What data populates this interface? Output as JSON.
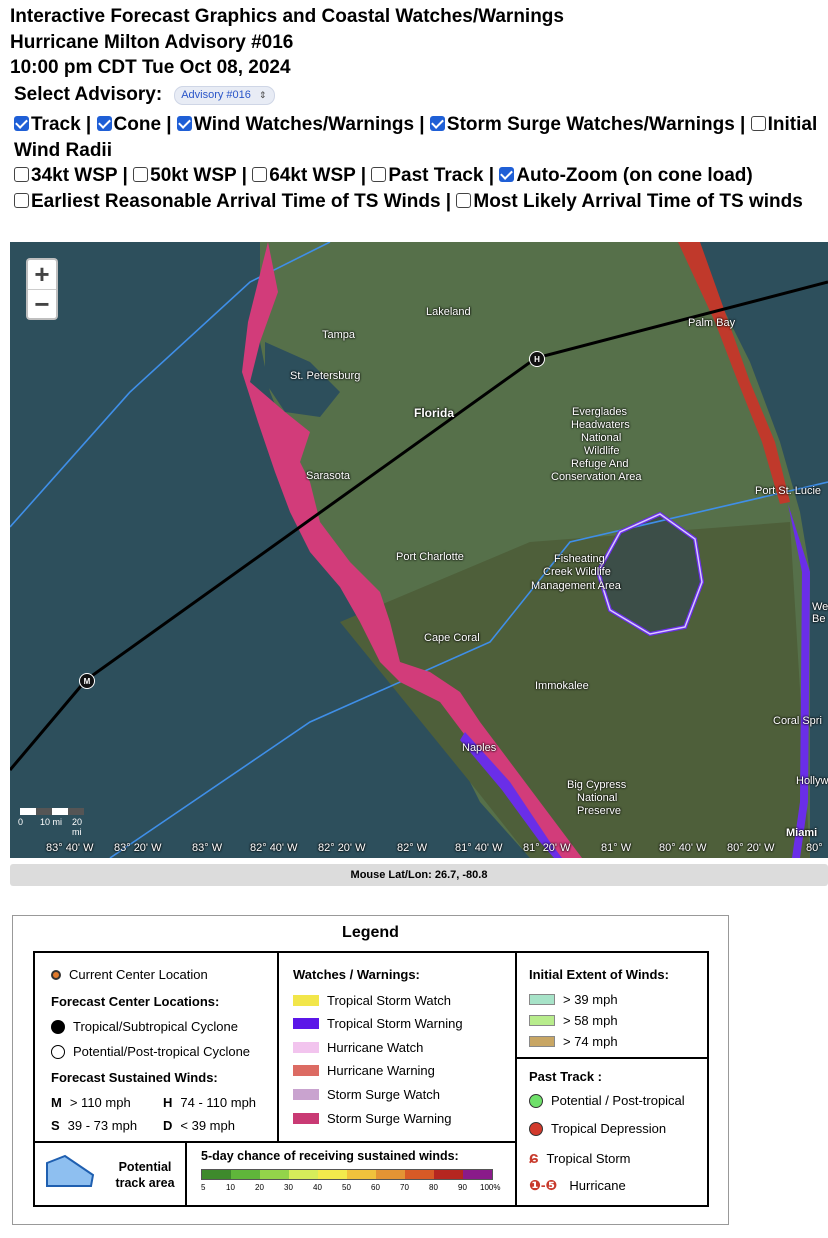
{
  "header": {
    "line1": "Interactive Forecast Graphics and Coastal Watches/Warnings",
    "line2": "Hurricane Milton Advisory #016",
    "line3": "10:00 pm CDT Tue Oct 08, 2024"
  },
  "advisory_select": {
    "label": "Select Advisory:",
    "value": "Advisory #016"
  },
  "options": [
    {
      "label": "Track |",
      "checked": true
    },
    {
      "label": "Cone |",
      "checked": true
    },
    {
      "label": "Wind Watches/Warnings |",
      "checked": true
    },
    {
      "label": "Storm Surge Watches/Warnings |",
      "checked": true
    },
    {
      "label": "Initial Wind Radii",
      "checked": false
    },
    {
      "label": "34kt WSP |",
      "checked": false
    },
    {
      "label": "50kt WSP |",
      "checked": false
    },
    {
      "label": "64kt WSP |",
      "checked": false
    },
    {
      "label": "Past Track |",
      "checked": false
    },
    {
      "label": "Auto-Zoom (on cone load)",
      "checked": true
    },
    {
      "label": "Earliest Reasonable Arrival Time of TS Winds |",
      "checked": false
    },
    {
      "label": "Most Likely Arrival Time of TS winds",
      "checked": false
    }
  ],
  "map": {
    "zoom_in": "+",
    "zoom_out": "−",
    "places": [
      "Lakeland",
      "Palm Bay",
      "Tampa",
      "St. Petersburg",
      "Florida",
      "Everglades",
      "Headwaters",
      "National",
      "Wildlife",
      "Refuge And",
      "Conservation Area",
      "Sarasota",
      "Port St. Lucie",
      "Port Charlotte",
      "Fisheating",
      "Creek Wildlife",
      "Management Area",
      "Cape Coral",
      "West Be",
      "Immokalee",
      "Coral Spri",
      "Naples",
      "Big Cypress",
      "National",
      "Preserve",
      "Hollyw",
      "Miami"
    ],
    "track_markers": [
      "H",
      "M"
    ],
    "scale_labels": [
      "0",
      "10 mi",
      "20 mi"
    ],
    "lon_labels": [
      "83° 40' W",
      "83° 20' W",
      "83° W",
      "82° 40' W",
      "82° 20' W",
      "82° W",
      "81° 40' W",
      "81° 20' W",
      "81° W",
      "80° 40' W",
      "80° 20' W",
      "80°"
    ],
    "colors": {
      "water": "#2d4f5c",
      "land": "#56704a",
      "cone": "#3f8fe8",
      "track": "#000000",
      "surge_warning": "#d23c7a",
      "hurricane_warning": "#c0392b",
      "ts_warning": "#6a2ee8"
    }
  },
  "mouse_readout": "Mouse Lat/Lon: 26.7, -80.8",
  "legend": {
    "title": "Legend",
    "current_center": "Current Center Location",
    "forecast_center_title": "Forecast Center Locations:",
    "tropical": "Tropical/Subtropical Cyclone",
    "post_tropical": "Potential/Post-tropical Cyclone",
    "winds_title": "Forecast Sustained Winds:",
    "winds": [
      {
        "code": "M",
        "text": "> 110 mph"
      },
      {
        "code": "H",
        "text": "74 - 110 mph"
      },
      {
        "code": "S",
        "text": "39 - 73 mph"
      },
      {
        "code": "D",
        "text": "< 39 mph"
      }
    ],
    "watches_title": "Watches / Warnings:",
    "watches": [
      {
        "label": "Tropical Storm Watch",
        "color": "#f2e64a"
      },
      {
        "label": "Tropical Storm Warning",
        "color": "#5b16e8"
      },
      {
        "label": "Hurricane Watch",
        "color": "#f2c4ee"
      },
      {
        "label": "Hurricane Warning",
        "color": "#dc6b63"
      },
      {
        "label": "Storm Surge Watch",
        "color": "#c9a3cf"
      },
      {
        "label": "Storm Surge Warning",
        "color": "#c93a74"
      }
    ],
    "extent_title": "Initial Extent of Winds:",
    "extent": [
      {
        "label": "> 39 mph",
        "color": "#a7e3c8"
      },
      {
        "label": "> 58 mph",
        "color": "#b8ec8c"
      },
      {
        "label": "> 74 mph",
        "color": "#c8a664"
      }
    ],
    "past_title": "Past Track :",
    "past": [
      {
        "label": "Potential / Post-tropical",
        "color": "#6fe06a"
      },
      {
        "label": "Tropical Depression",
        "color": "#d23a2c"
      },
      {
        "label": "Tropical Storm",
        "color": "#c83a2c"
      },
      {
        "label": "Hurricane",
        "color": "#c83a2c"
      }
    ],
    "potential_area": "Potential track area",
    "wsp_title": "5-day chance of receiving sustained winds:",
    "wsp_labels": [
      "5",
      "10",
      "20",
      "30",
      "40",
      "50",
      "60",
      "70",
      "80",
      "90",
      "100%"
    ],
    "wsp_colors": [
      "#3e8a2c",
      "#5fb63a",
      "#93d44a",
      "#d6ec5a",
      "#f3ea4c",
      "#f1c23c",
      "#e49434",
      "#d85a26",
      "#b52620",
      "#8a1618",
      "#8a1a8a"
    ]
  }
}
